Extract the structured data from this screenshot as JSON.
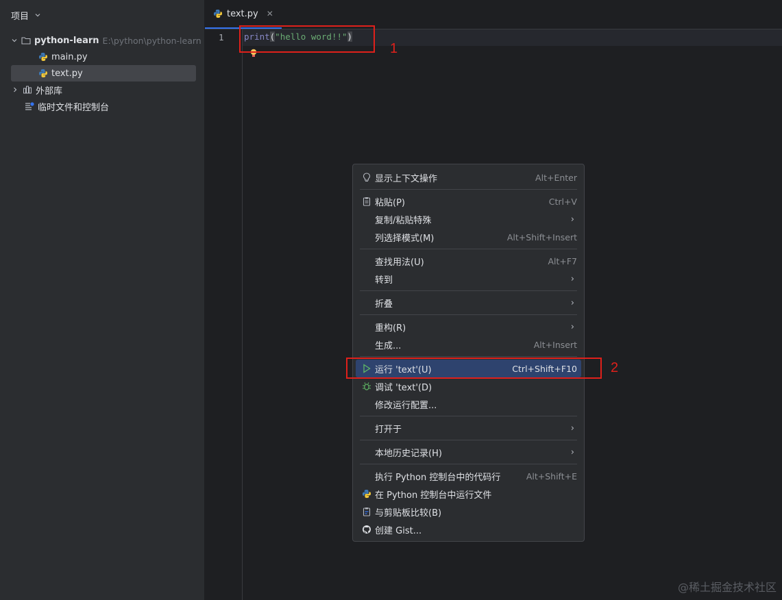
{
  "project_panel": {
    "title": "项目",
    "tree": {
      "root_name": "python-learn",
      "root_path": "E:\\python\\python-learn",
      "file1": "main.py",
      "file2": "text.py",
      "external_libs": "外部库",
      "scratches": "临时文件和控制台"
    }
  },
  "editor": {
    "tab_label": "text.py",
    "line_number": "1",
    "code": {
      "func": "print",
      "open": "(",
      "string": "\"hello word!!\"",
      "close": ")"
    }
  },
  "annotations": {
    "label1": "1",
    "label2": "2"
  },
  "context_menu": {
    "items": [
      {
        "label": "显示上下文操作",
        "shortcut": "Alt+Enter",
        "icon": "lightbulb-icon"
      },
      {
        "label": "粘贴(P)",
        "shortcut": "Ctrl+V",
        "icon": "clipboard-icon"
      },
      {
        "label": "复制/粘贴特殊",
        "shortcut": "",
        "submenu": true
      },
      {
        "label": "列选择模式(M)",
        "shortcut": "Alt+Shift+Insert"
      },
      {
        "label": "查找用法(U)",
        "shortcut": "Alt+F7"
      },
      {
        "label": "转到",
        "shortcut": "",
        "submenu": true
      },
      {
        "label": "折叠",
        "shortcut": "",
        "submenu": true
      },
      {
        "label": "重构(R)",
        "shortcut": "",
        "submenu": true
      },
      {
        "label": "生成...",
        "shortcut": "Alt+Insert"
      },
      {
        "label": "运行 'text'(U)",
        "shortcut": "Ctrl+Shift+F10",
        "icon": "run-icon"
      },
      {
        "label": "调试 'text'(D)",
        "shortcut": "",
        "icon": "debug-icon"
      },
      {
        "label": "修改运行配置...",
        "shortcut": ""
      },
      {
        "label": "打开于",
        "shortcut": "",
        "submenu": true
      },
      {
        "label": "本地历史记录(H)",
        "shortcut": "",
        "submenu": true
      },
      {
        "label": "执行 Python 控制台中的代码行",
        "shortcut": "Alt+Shift+E"
      },
      {
        "label": "在 Python 控制台中运行文件",
        "shortcut": "",
        "icon": "python-icon"
      },
      {
        "label": "与剪贴板比较(B)",
        "shortcut": "",
        "icon": "compare-icon"
      },
      {
        "label": "创建 Gist...",
        "shortcut": "",
        "icon": "github-icon"
      }
    ],
    "submenu_glyph": "›"
  },
  "watermark": "@稀土掘金技术社区",
  "colors": {
    "accent": "#3574f0",
    "annotation_red": "#e0201b",
    "menu_highlight": "#2e436e",
    "string_green": "#6aab73"
  }
}
